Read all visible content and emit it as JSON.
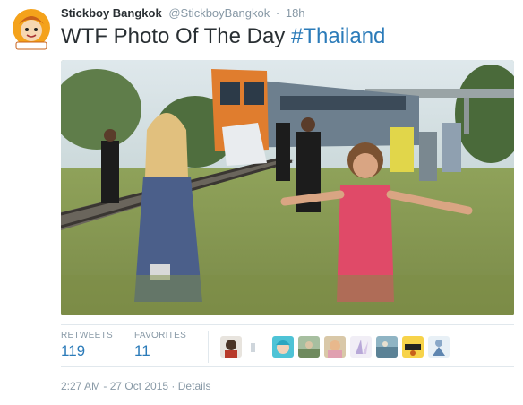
{
  "author": {
    "display_name": "Stickboy Bangkok",
    "handle": "@StickboyBangkok",
    "separator": "·",
    "time_ago": "18h",
    "avatar_text_top": "Stickboy",
    "avatar_text_bottom": "Bangkok"
  },
  "tweet": {
    "text": "WTF Photo Of The Day",
    "hashtag": "#Thailand"
  },
  "stats": {
    "retweets_label": "RETWEETS",
    "retweets_value": "119",
    "favorites_label": "FAVORITES",
    "favorites_value": "11"
  },
  "footer": {
    "timestamp": "2:27 AM - 27 Oct 2015",
    "separator": "·",
    "details_label": "Details"
  },
  "colors": {
    "link": "#2b7bb9",
    "muted": "#8899a6",
    "text": "#292f33",
    "border": "#e1e8ed"
  },
  "icons": {
    "avatar": "stickboy-logo",
    "favoriters": [
      "user-avatar",
      "user-avatar",
      "user-avatar",
      "user-avatar",
      "user-avatar",
      "user-avatar",
      "user-avatar",
      "user-avatar",
      "user-avatar"
    ]
  }
}
